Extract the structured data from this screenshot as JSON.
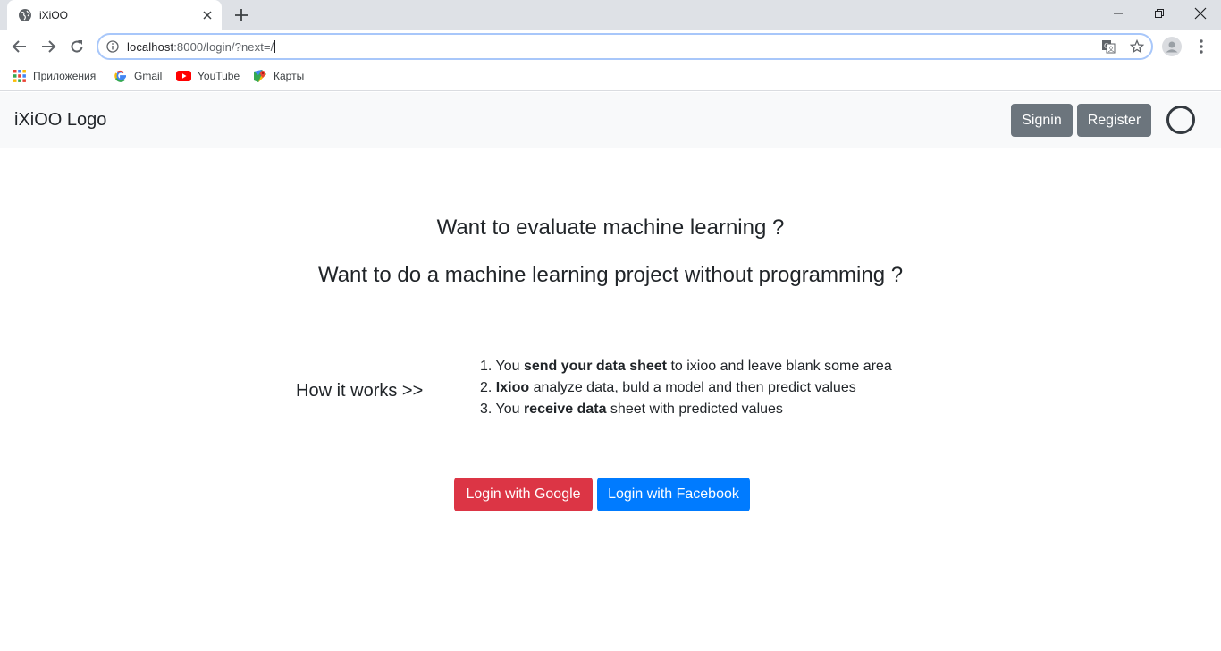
{
  "browser": {
    "tab_title": "iXiOO",
    "url_host": "localhost",
    "url_rest": ":8000/login/?next=/",
    "bookmarks": [
      "Приложения",
      "Gmail",
      "YouTube",
      "Карты"
    ]
  },
  "navbar": {
    "brand": "iXiOO Logo",
    "signin": "Signin",
    "register": "Register"
  },
  "main": {
    "headline1": "Want to evaluate machine learning ?",
    "headline2": "Want to do a machine learning project without programming ?",
    "how_label": "How it works >>",
    "steps": [
      {
        "pre": "1. You ",
        "bold": "send your data sheet",
        "post": " to ixioo and leave blank some area"
      },
      {
        "pre": "2. ",
        "bold": "Ixioo",
        "post": " analyze data, buld a model and then predict values"
      },
      {
        "pre": "3. You ",
        "bold": "receive data",
        "post": " sheet with predicted values"
      }
    ]
  },
  "login": {
    "google": "Login with Google",
    "facebook": "Login with Facebook"
  },
  "colors": {
    "google_red": "#dc3545",
    "facebook_blue": "#007bff",
    "secondary_grey": "#6c757d"
  }
}
